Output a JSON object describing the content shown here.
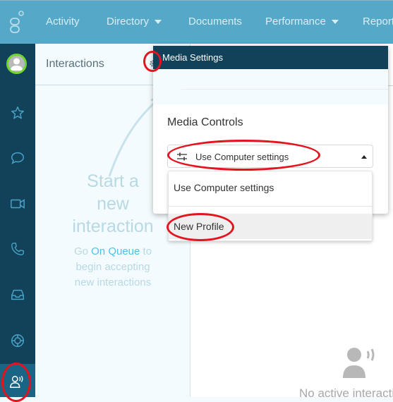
{
  "topnav": {
    "logo_icon": "genesys-logo-icon",
    "items": [
      {
        "label": "Activity",
        "has_dropdown": false
      },
      {
        "label": "Directory",
        "has_dropdown": true
      },
      {
        "label": "Documents",
        "has_dropdown": false
      },
      {
        "label": "Performance",
        "has_dropdown": true
      },
      {
        "label": "Reports",
        "has_dropdown": false
      }
    ]
  },
  "sidebar": {
    "items": [
      {
        "icon": "user-avatar-icon",
        "status_color": "#6fd62f"
      },
      {
        "icon": "star-icon"
      },
      {
        "icon": "chat-bubble-icon"
      },
      {
        "icon": "video-camera-icon"
      },
      {
        "icon": "phone-icon"
      },
      {
        "icon": "inbox-tray-icon"
      },
      {
        "icon": "lifebuoy-icon"
      },
      {
        "icon": "interactions-person-speaking-icon",
        "active": true
      }
    ]
  },
  "interactions_panel": {
    "title": "Interactions",
    "settings_icon": "gear-icon",
    "empty_state": {
      "title_lines": [
        "Start a",
        "new",
        "interaction"
      ],
      "sub_prefix": "Go ",
      "sub_link": "On Queue",
      "sub_suffix_1": " to",
      "sub_line_2": "begin accepting",
      "sub_line_3": "new interactions"
    }
  },
  "main": {
    "no_active_icon": "person-speaking-icon",
    "no_active_text": "No active interactions"
  },
  "media_settings": {
    "title": "Media Settings",
    "section_label": "Media Controls",
    "select": {
      "icon": "sliders-icon",
      "value": "Use Computer settings",
      "expanded": true
    },
    "options": [
      "Use Computer settings",
      "New Profile"
    ],
    "highlighted_option": "New Profile"
  },
  "colors": {
    "topbar": "#56a8c8",
    "sidebar": "#12425a",
    "modal_header": "#12425a",
    "link": "#4ec1e8",
    "annotation": "#e3141e"
  }
}
